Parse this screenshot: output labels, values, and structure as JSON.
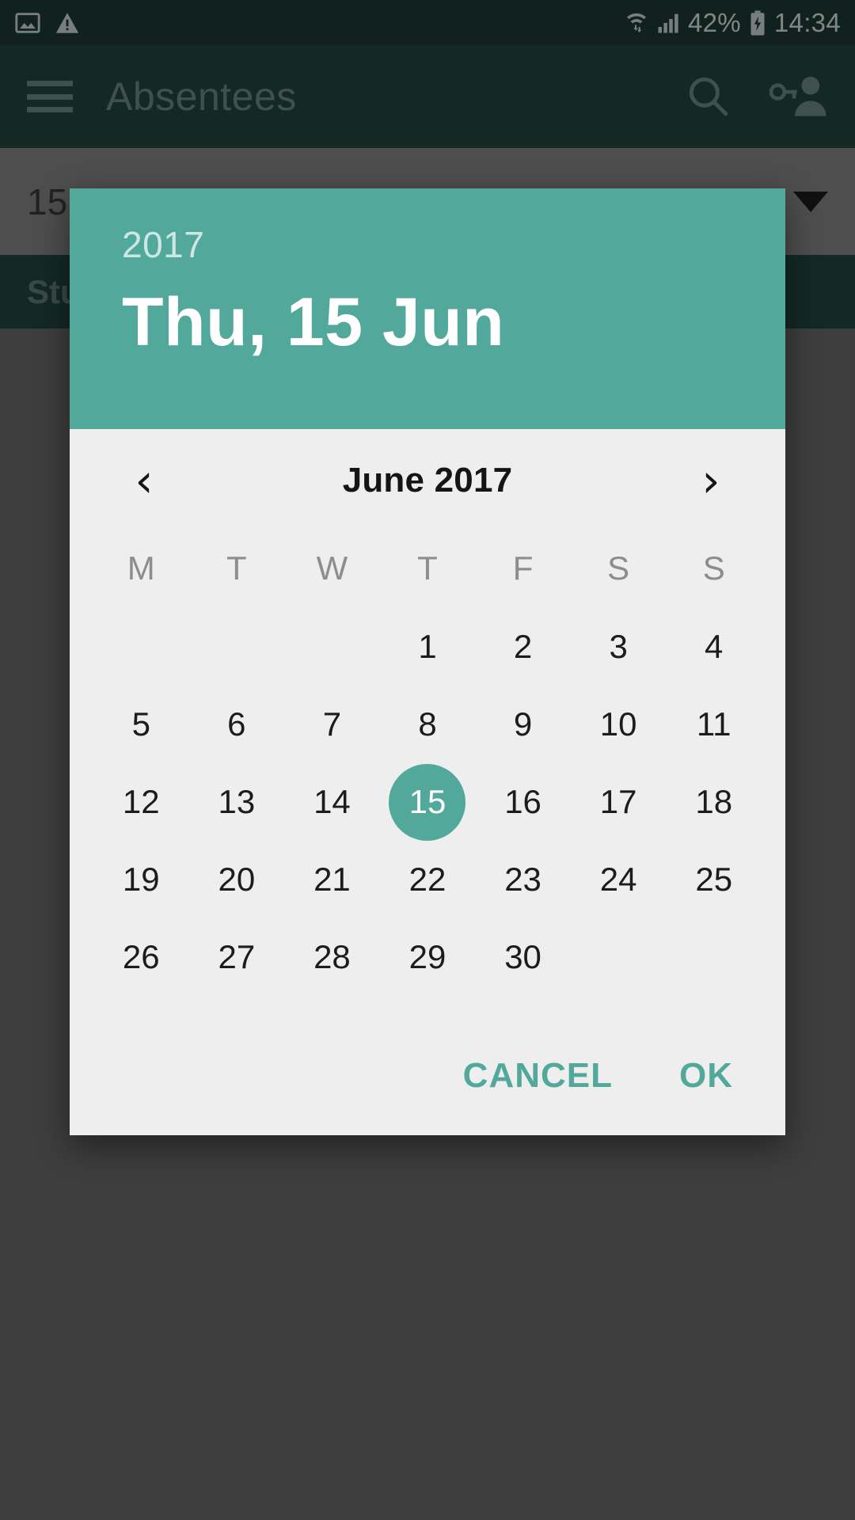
{
  "status_bar": {
    "icons_left": [
      "image-icon",
      "warning-icon"
    ],
    "icons_right": [
      "wifi-transfer-icon",
      "signal-bars-icon",
      "battery-charging-icon"
    ],
    "battery_percent": "42%",
    "clock": "14:34"
  },
  "app_bar": {
    "menu_icon": "hamburger-icon",
    "title": "Absentees",
    "search_icon": "search-icon",
    "account_key_icon": "person-key-icon"
  },
  "background_content": {
    "date_spinner_value": "15",
    "date_spinner_caret": "dropdown-caret-icon",
    "table_header_student": "Stu"
  },
  "dialog": {
    "header": {
      "year": "2017",
      "date": "Thu, 15 Jun"
    },
    "month_nav": {
      "prev_label": "‹",
      "prev_icon": "chevron-left-icon",
      "month_label": "June 2017",
      "next_label": "›",
      "next_icon": "chevron-right-icon"
    },
    "weekdays": [
      "M",
      "T",
      "W",
      "T",
      "F",
      "S",
      "S"
    ],
    "days": [
      "",
      "",
      "",
      "1",
      "2",
      "3",
      "4",
      "5",
      "6",
      "7",
      "8",
      "9",
      "10",
      "11",
      "12",
      "13",
      "14",
      "15",
      "16",
      "17",
      "18",
      "19",
      "20",
      "21",
      "22",
      "23",
      "24",
      "25",
      "26",
      "27",
      "28",
      "29",
      "30",
      "",
      ""
    ],
    "selected_day": "15",
    "actions": {
      "cancel_label": "CANCEL",
      "ok_label": "OK"
    }
  },
  "colors": {
    "accent_teal": "#52a99b",
    "app_bar_dark": "#24473f",
    "status_bar_dark": "#1d3a34",
    "dialog_body": "#eeeeee"
  }
}
